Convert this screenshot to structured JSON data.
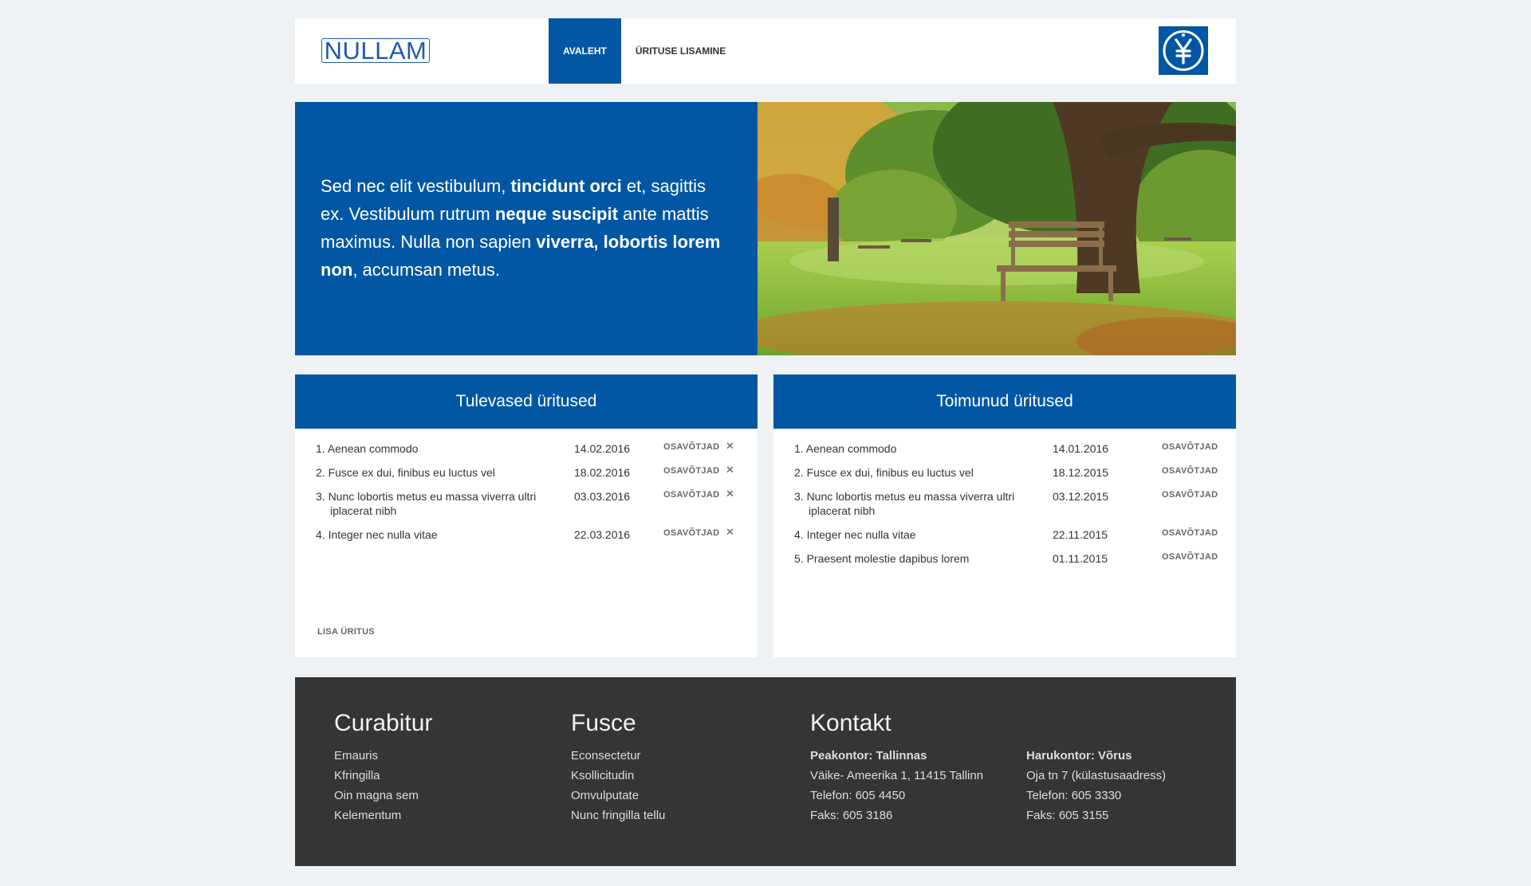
{
  "header": {
    "logo_text": "NULLAM",
    "nav": [
      {
        "label": "AVALEHT"
      },
      {
        "label": "ÜRITUSE LISAMINE"
      }
    ],
    "badge_icon": "yen-symbol-emblem-icon"
  },
  "hero": {
    "text_parts": [
      "Sed nec elit vestibulum, ",
      "tincidunt orci",
      " et, sagittis ex. Vestibulum rutrum ",
      "neque suscipit",
      " ante mattis maximus. Nulla non sapien ",
      "viverra, lobortis lorem non",
      ", accumsan metus."
    ],
    "image": "park-bench-under-tree-autumn"
  },
  "upcoming": {
    "title": "Tulevased üritused",
    "events": [
      {
        "name": "1. Aenean commodo",
        "date": "14.02.2016",
        "action": "OSAVÕTJAD"
      },
      {
        "name": "2. Fusce ex dui, finibus eu luctus vel",
        "date": "18.02.2016",
        "action": "OSAVÕTJAD"
      },
      {
        "name": "3. Nunc lobortis metus eu massa viverra ultri iplacerat nibh",
        "date": "03.03.2016",
        "action": "OSAVÕTJAD"
      },
      {
        "name": "4. Integer nec nulla vitae",
        "date": "22.03.2016",
        "action": "OSAVÕTJAD"
      }
    ],
    "remove_icon": "close-icon",
    "add_label": "LISA ÜRITUS"
  },
  "past": {
    "title": "Toimunud üritused",
    "events": [
      {
        "name": "1. Aenean commodo",
        "date": "14.01.2016",
        "action": "OSAVÕTJAD"
      },
      {
        "name": "2. Fusce ex dui, finibus eu luctus vel",
        "date": "18.12.2015",
        "action": "OSAVÕTJAD"
      },
      {
        "name": "3. Nunc lobortis metus eu massa viverra ultri iplacerat nibh",
        "date": "03.12.2015",
        "action": "OSAVÕTJAD"
      },
      {
        "name": "4. Integer nec nulla vitae",
        "date": "22.11.2015",
        "action": "OSAVÕTJAD"
      },
      {
        "name": "5. Praesent molestie dapibus lorem",
        "date": "01.11.2015",
        "action": "OSAVÕTJAD"
      }
    ]
  },
  "footer": {
    "col1": {
      "title": "Curabitur",
      "links": [
        "Emauris",
        "Kfringilla",
        "Oin magna sem",
        "Kelementum"
      ]
    },
    "col2": {
      "title": "Fusce",
      "links": [
        "Econsectetur",
        "Ksollicitudin",
        "Omvulputate",
        "Nunc fringilla tellu"
      ]
    },
    "contact": {
      "title": "Kontakt",
      "main": {
        "heading": "Peakontor: Tallinnas",
        "lines": [
          "Väike- Ameerika 1, 11415 Tallinn",
          "Telefon: 605 4450",
          "Faks: 605 3186"
        ]
      },
      "branch": {
        "heading": "Harukontor: Võrus",
        "lines": [
          "Oja tn 7 (külastusaadress)",
          "Telefon: 605 3330",
          "Faks: 605 3155"
        ]
      }
    }
  },
  "colors": {
    "brand_blue": "#0157a3",
    "page_bg": "#eef2f5",
    "footer_bg": "#353535"
  }
}
